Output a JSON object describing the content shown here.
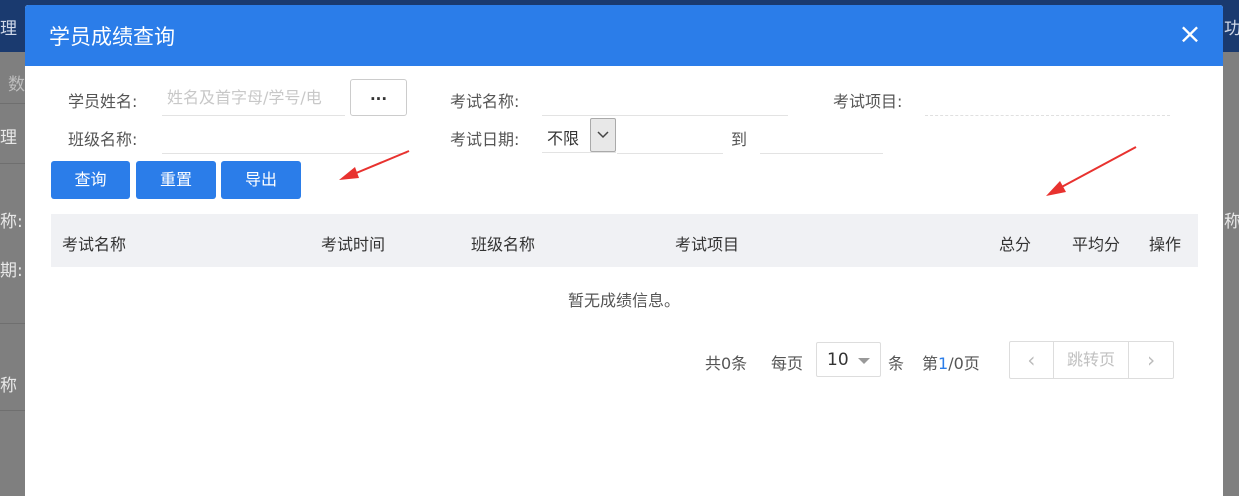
{
  "background": {
    "texts": [
      "理",
      "数",
      "理",
      "称:",
      "期:",
      "称",
      "功",
      "称"
    ]
  },
  "modal": {
    "title": "学员成绩查询",
    "close_icon": "×"
  },
  "form": {
    "student_name_label": "学员姓名:",
    "student_name_placeholder": "姓名及首字母/学号/电",
    "dots_label": "...",
    "exam_name_label": "考试名称:",
    "exam_item_label": "考试项目:",
    "class_name_label": "班级名称:",
    "exam_date_label": "考试日期:",
    "date_range_value": "不限",
    "to_label": "到"
  },
  "buttons": {
    "query": "查询",
    "reset": "重置",
    "export": "导出"
  },
  "table": {
    "columns": [
      "考试名称",
      "考试时间",
      "班级名称",
      "考试项目",
      "总分",
      "平均分",
      "操作"
    ],
    "empty_message": "暂无成绩信息。"
  },
  "pager": {
    "total": "共0条",
    "per_page_prefix": "每页",
    "page_size": "10",
    "per_page_suffix": "条",
    "page_prefix": "第",
    "current_page": "1",
    "page_suffix": "/0页",
    "jump_label": "跳转页",
    "prev_icon": "‹",
    "next_icon": "›"
  },
  "colors": {
    "accent": "#2b7de9",
    "annotation_arrow": "#e8322f"
  }
}
